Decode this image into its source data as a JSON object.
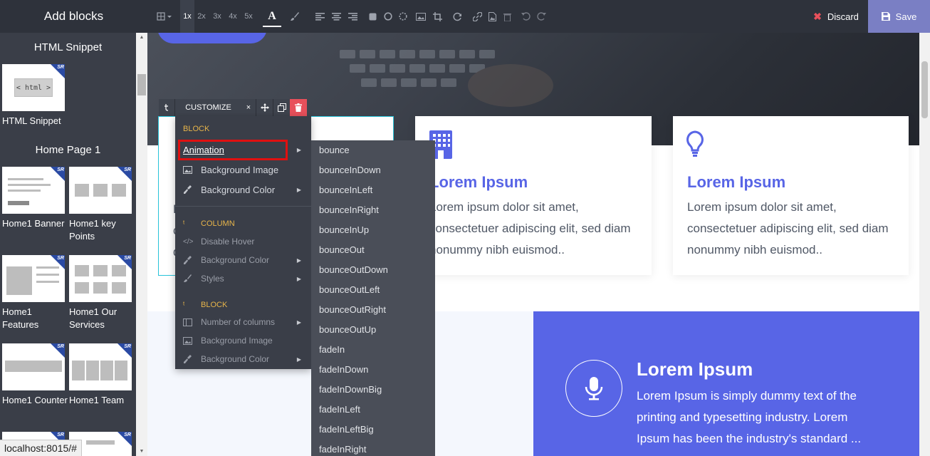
{
  "sidebar": {
    "title": "Add blocks",
    "sections": [
      {
        "title": "HTML Snippet",
        "blocks": [
          {
            "label": "HTML Snippet",
            "thumb_text": "< html >"
          }
        ]
      },
      {
        "title": "Home Page 1",
        "blocks": [
          {
            "label": "Home1 Banner"
          },
          {
            "label": "Home1 key Points"
          },
          {
            "label": "Home1 Features"
          },
          {
            "label": "Home1 Our Services"
          },
          {
            "label": "Home1 Counter"
          },
          {
            "label": "Home1 Team"
          }
        ]
      }
    ],
    "thumb_badge": "SR"
  },
  "toolbar": {
    "zoom_levels": [
      "1x",
      "2x",
      "3x",
      "4x",
      "5x"
    ],
    "active_zoom": "1x",
    "discard_label": "Discard",
    "save_label": "Save",
    "icons": [
      "grid-dropdown-icon",
      "text-font-icon",
      "paint-brush-icon",
      "align-left-icon",
      "align-center-icon",
      "align-right-icon",
      "square-icon",
      "circle-icon",
      "circle-dashed-icon",
      "image-icon",
      "crop-icon",
      "refresh-icon",
      "link-icon",
      "file-image-icon",
      "trash-icon",
      "undo-icon",
      "redo-icon"
    ]
  },
  "element_toolbar": {
    "label": "CUSTOMIZE",
    "close": "×"
  },
  "context_menu": {
    "groups": [
      {
        "header": "BLOCK",
        "items": [
          {
            "label": "Animation",
            "has_submenu": true,
            "icon": "none"
          },
          {
            "label": "Background Image",
            "has_submenu": false,
            "icon": "image-icon"
          },
          {
            "label": "Background Color",
            "has_submenu": true,
            "icon": "eyedropper-icon"
          }
        ]
      },
      {
        "header": "COLUMN",
        "items": [
          {
            "label": "Disable Hover",
            "has_submenu": false,
            "icon": "code-icon"
          },
          {
            "label": "Background Color",
            "has_submenu": true,
            "icon": "eyedropper-icon"
          },
          {
            "label": "Styles",
            "has_submenu": true,
            "icon": "brush-icon"
          }
        ]
      },
      {
        "header": "BLOCK",
        "items": [
          {
            "label": "Number of columns",
            "has_submenu": true,
            "icon": "columns-icon"
          },
          {
            "label": "Background Image",
            "has_submenu": false,
            "icon": "image-icon"
          },
          {
            "label": "Background Color",
            "has_submenu": true,
            "icon": "eyedropper-icon"
          }
        ]
      }
    ]
  },
  "animation_submenu": {
    "items": [
      "bounce",
      "bounceInDown",
      "bounceInLeft",
      "bounceInRight",
      "bounceInUp",
      "bounceOut",
      "bounceOutDown",
      "bounceOutLeft",
      "bounceOutRight",
      "bounceOutUp",
      "fadeIn",
      "fadeInDown",
      "fadeInDownBig",
      "fadeInLeft",
      "fadeInLeftBig",
      "fadeInRight"
    ]
  },
  "page": {
    "cards": [
      {
        "title": "Lorem Ipsum",
        "text": "Lorem ipsum dolor sit amet, consectetuer adipiscing elit, sed diam nonummy nibh euismod..",
        "icon": "building-icon"
      },
      {
        "title": "Lorem Ipsum",
        "text": "Lorem ipsum dolor sit amet, consectetuer adipiscing elit, sed diam nonummy nibh euismod..",
        "icon": "lightbulb-icon"
      }
    ],
    "first_card_partial": [
      "L",
      "c",
      "d"
    ],
    "feature": {
      "title": "Lorem Ipsum",
      "text": "Lorem Ipsum is simply dummy text of the printing and typesetting industry. Lorem Ipsum has been the industry's standard ...",
      "icon": "microphone-icon"
    }
  },
  "status_bar": "localhost:8015/#",
  "colors": {
    "accent": "#5865e6",
    "toolbar_bg": "#2e323b",
    "sidebar_bg": "#3a3e48",
    "delete": "#e8505b",
    "highlight": "#e01010",
    "section_header": "#e8b54a"
  }
}
